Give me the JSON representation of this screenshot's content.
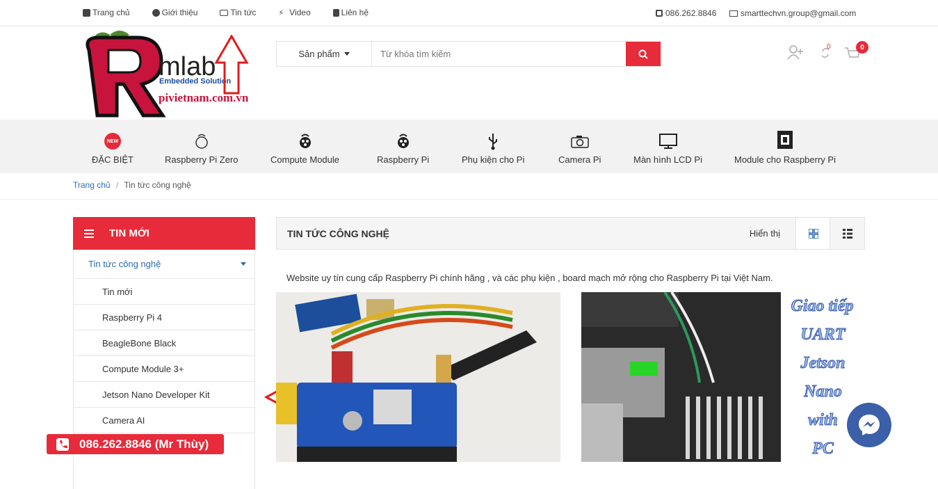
{
  "topbar": {
    "nav": [
      {
        "label": "Trang chủ",
        "icon": "home-icon"
      },
      {
        "label": "Giới thiệu",
        "icon": "info-icon"
      },
      {
        "label": "Tin tức",
        "icon": "news-icon"
      },
      {
        "label": "Video",
        "icon": "bolt-icon"
      },
      {
        "label": "Liên hệ",
        "icon": "contact-icon"
      }
    ],
    "phone": "086.262.8846",
    "email": "smarttechvn.group@gmail.com"
  },
  "logo": {
    "brand": "mlab",
    "tagline": "Embedded Solution",
    "site": "pivietnam.com.vn"
  },
  "search": {
    "category": "Sản phẩm",
    "placeholder": "Từ khóa tìm kiếm"
  },
  "header_icons": {
    "compare_count": "0",
    "cart_count": "0"
  },
  "categories": [
    {
      "label": "ĐẶC BIỆT",
      "icon": "new-badge-icon"
    },
    {
      "label": "Raspberry Pi Zero",
      "icon": "raspberry-outline-icon"
    },
    {
      "label": "Compute Module",
      "icon": "raspberry-icon"
    },
    {
      "label": "Raspberry Pi",
      "icon": "raspberry-icon"
    },
    {
      "label": "Phụ kiện cho Pi",
      "icon": "usb-icon"
    },
    {
      "label": "Camera Pi",
      "icon": "camera-icon"
    },
    {
      "label": "Màn hình LCD Pi",
      "icon": "monitor-icon"
    },
    {
      "label": "Module cho Raspberry Pi",
      "icon": "chip-icon"
    }
  ],
  "breadcrumb": {
    "home": "Trang chủ",
    "separator": "/",
    "current": "Tin tức công nghệ"
  },
  "sidebar": {
    "title": "TIN MỚI",
    "section": "Tin tức công nghệ",
    "items": [
      "Tin mới",
      "Raspberry Pi 4",
      "BeagleBone Black",
      "Compute Module 3+",
      "Jetson Nano Developer Kit",
      "Camera AI"
    ]
  },
  "main": {
    "title": "TIN TỨC CÔNG NGHỆ",
    "display_label": "Hiển thị",
    "description": "Website uy tín cung cấp Raspberry Pi chính hãng , và các phụ kiện , board mạch mở rộng cho Raspberry Pi tại Việt Nam.",
    "article2_overlay": [
      "Giao tiếp",
      "UART",
      "Jetson",
      "Nano",
      "with",
      "PC"
    ]
  },
  "hotline": "086.262.8846 (Mr Thùy)",
  "colors": {
    "accent": "#e72b3a",
    "link": "#2f6bb0",
    "messenger": "#3b5fa8"
  }
}
